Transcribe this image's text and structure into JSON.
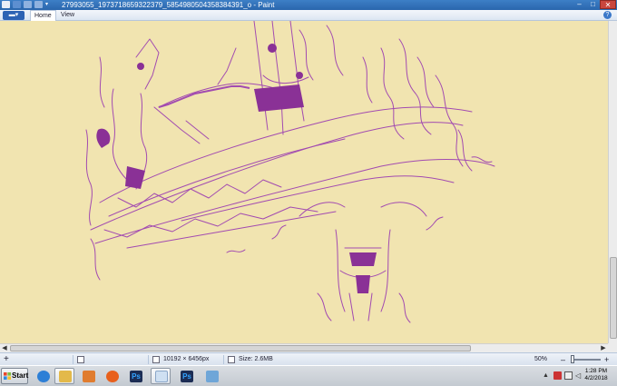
{
  "window": {
    "title": "27993055_1973718659322379_5854980504358384391_o - Paint",
    "controls": {
      "minimize": "–",
      "maximize": "□",
      "close": "✕"
    }
  },
  "ribbon": {
    "file_menu_glyph": "▾",
    "tabs": [
      {
        "label": "Home",
        "active": true
      },
      {
        "label": "View",
        "active": false
      }
    ],
    "help_glyph": "?"
  },
  "statusbar": {
    "add_glyph": "+",
    "dimensions": "10192 × 6456px",
    "size": "Size: 2.6MB",
    "zoom_level": "50%",
    "zoom_out_glyph": "–",
    "zoom_in_glyph": "+"
  },
  "taskbar": {
    "start_label": "Start",
    "pinned": [
      {
        "name": "internet-explorer",
        "color": "#2d7fd6"
      },
      {
        "name": "file-explorer",
        "color": "#e3b94a"
      },
      {
        "name": "media-player",
        "color": "#e07c2f"
      },
      {
        "name": "firefox",
        "color": "#e8601c"
      },
      {
        "name": "photoshop",
        "color": "#1c2d55",
        "label": "Ps"
      },
      {
        "name": "paint",
        "color": "#cfe0f2"
      },
      {
        "name": "photoshop-2",
        "color": "#1c2d55",
        "label": "Ps"
      },
      {
        "name": "generic-app",
        "color": "#6fa6d8"
      }
    ],
    "clock_time": "1:28 PM",
    "clock_date": "4/2/2018"
  },
  "colors": {
    "canvas_background": "#f1e4b0",
    "ink": "#a24bb0",
    "ink_dark": "#8a3196",
    "titlebar": "#2f6db5"
  }
}
